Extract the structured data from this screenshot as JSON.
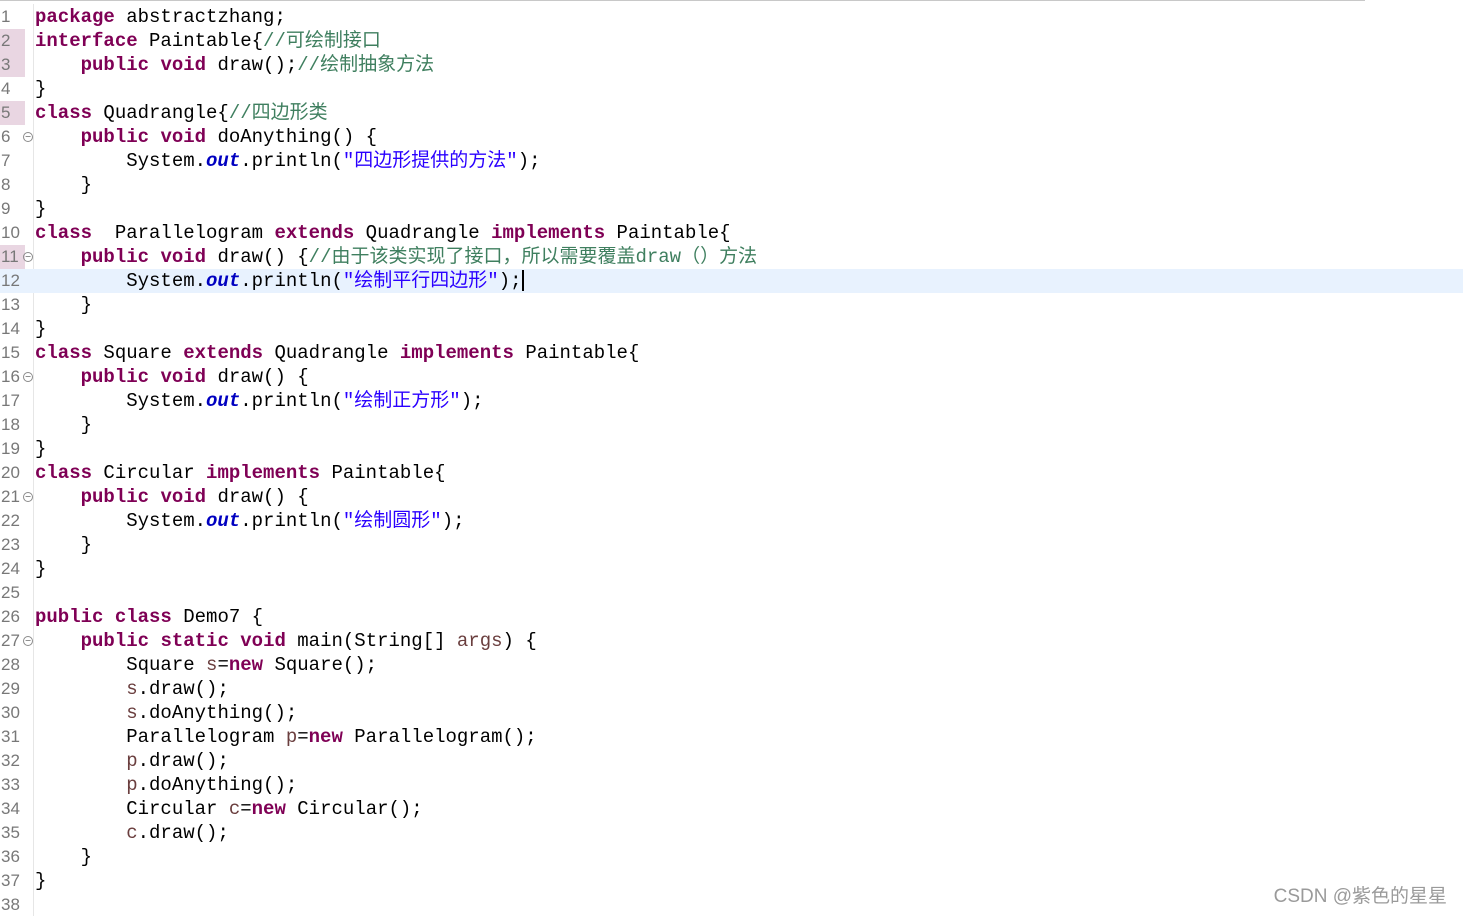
{
  "editor": {
    "language": "java",
    "current_line": 12,
    "lines": [
      {
        "n": "1",
        "tokens": [
          [
            "kw",
            "package"
          ],
          [
            "t",
            " abstractzhang;"
          ]
        ]
      },
      {
        "n": "2",
        "mark": true,
        "tokens": [
          [
            "kw",
            "interface"
          ],
          [
            "t",
            " Paintable{"
          ],
          [
            "cmt",
            "//可绘制接口"
          ]
        ]
      },
      {
        "n": "3",
        "mark": true,
        "tokens": [
          [
            "t",
            "    "
          ],
          [
            "kw",
            "public"
          ],
          [
            "t",
            " "
          ],
          [
            "kw",
            "void"
          ],
          [
            "t",
            " draw();"
          ],
          [
            "cmt",
            "//绘制抽象方法"
          ]
        ]
      },
      {
        "n": "4",
        "tokens": [
          [
            "t",
            "}"
          ]
        ]
      },
      {
        "n": "5",
        "mark": true,
        "tokens": [
          [
            "kw",
            "class"
          ],
          [
            "t",
            " Quadrangle{"
          ],
          [
            "cmt",
            "//四边形类"
          ]
        ]
      },
      {
        "n": "6",
        "fold": true,
        "tokens": [
          [
            "t",
            "    "
          ],
          [
            "kw",
            "public"
          ],
          [
            "t",
            " "
          ],
          [
            "kw",
            "void"
          ],
          [
            "t",
            " doAnything() {"
          ]
        ]
      },
      {
        "n": "7",
        "tokens": [
          [
            "t",
            "        System."
          ],
          [
            "fld",
            "out"
          ],
          [
            "t",
            ".println("
          ],
          [
            "str",
            "\"四边形提供的方法\""
          ],
          [
            "t",
            ");"
          ]
        ]
      },
      {
        "n": "8",
        "tokens": [
          [
            "t",
            "    }"
          ]
        ]
      },
      {
        "n": "9",
        "tokens": [
          [
            "t",
            "}"
          ]
        ]
      },
      {
        "n": "10",
        "tokens": [
          [
            "kw",
            "class"
          ],
          [
            "t",
            "  Parallelogram "
          ],
          [
            "kw",
            "extends"
          ],
          [
            "t",
            " Quadrangle "
          ],
          [
            "kw",
            "implements"
          ],
          [
            "t",
            " Paintable{"
          ]
        ]
      },
      {
        "n": "11",
        "fold": true,
        "mark": true,
        "tokens": [
          [
            "t",
            "    "
          ],
          [
            "kw",
            "public"
          ],
          [
            "t",
            " "
          ],
          [
            "kw",
            "void"
          ],
          [
            "t",
            " draw() {"
          ],
          [
            "cmt",
            "//由于该类实现了接口，所以需要覆盖draw（）方法"
          ]
        ]
      },
      {
        "n": "12",
        "caret": true,
        "tokens": [
          [
            "t",
            "        System."
          ],
          [
            "fld",
            "out"
          ],
          [
            "t",
            ".println("
          ],
          [
            "str",
            "\"绘制平行四边形\""
          ],
          [
            "t",
            ");"
          ]
        ]
      },
      {
        "n": "13",
        "tokens": [
          [
            "t",
            "    }"
          ]
        ]
      },
      {
        "n": "14",
        "tokens": [
          [
            "t",
            "}"
          ]
        ]
      },
      {
        "n": "15",
        "tokens": [
          [
            "kw",
            "class"
          ],
          [
            "t",
            " Square "
          ],
          [
            "kw",
            "extends"
          ],
          [
            "t",
            " Quadrangle "
          ],
          [
            "kw",
            "implements"
          ],
          [
            "t",
            " Paintable{"
          ]
        ]
      },
      {
        "n": "16",
        "fold": true,
        "tokens": [
          [
            "t",
            "    "
          ],
          [
            "kw",
            "public"
          ],
          [
            "t",
            " "
          ],
          [
            "kw",
            "void"
          ],
          [
            "t",
            " draw() {"
          ]
        ]
      },
      {
        "n": "17",
        "tokens": [
          [
            "t",
            "        System."
          ],
          [
            "fld",
            "out"
          ],
          [
            "t",
            ".println("
          ],
          [
            "str",
            "\"绘制正方形\""
          ],
          [
            "t",
            ");"
          ]
        ]
      },
      {
        "n": "18",
        "tokens": [
          [
            "t",
            "    }"
          ]
        ]
      },
      {
        "n": "19",
        "tokens": [
          [
            "t",
            "}"
          ]
        ]
      },
      {
        "n": "20",
        "tokens": [
          [
            "kw",
            "class"
          ],
          [
            "t",
            " Circular "
          ],
          [
            "kw",
            "implements"
          ],
          [
            "t",
            " Paintable{"
          ]
        ]
      },
      {
        "n": "21",
        "fold": true,
        "tokens": [
          [
            "t",
            "    "
          ],
          [
            "kw",
            "public"
          ],
          [
            "t",
            " "
          ],
          [
            "kw",
            "void"
          ],
          [
            "t",
            " draw() {"
          ]
        ]
      },
      {
        "n": "22",
        "tokens": [
          [
            "t",
            "        System."
          ],
          [
            "fld",
            "out"
          ],
          [
            "t",
            ".println("
          ],
          [
            "str",
            "\"绘制圆形\""
          ],
          [
            "t",
            ");"
          ]
        ]
      },
      {
        "n": "23",
        "tokens": [
          [
            "t",
            "    }"
          ]
        ]
      },
      {
        "n": "24",
        "tokens": [
          [
            "t",
            "}"
          ]
        ]
      },
      {
        "n": "25",
        "tokens": []
      },
      {
        "n": "26",
        "tokens": [
          [
            "kw",
            "public"
          ],
          [
            "t",
            " "
          ],
          [
            "kw",
            "class"
          ],
          [
            "t",
            " Demo7 {"
          ]
        ]
      },
      {
        "n": "27",
        "fold": true,
        "tokens": [
          [
            "t",
            "    "
          ],
          [
            "kw",
            "public"
          ],
          [
            "t",
            " "
          ],
          [
            "kw",
            "static"
          ],
          [
            "t",
            " "
          ],
          [
            "kw",
            "void"
          ],
          [
            "t",
            " main(String[] "
          ],
          [
            "var",
            "args"
          ],
          [
            "t",
            ") {"
          ]
        ]
      },
      {
        "n": "28",
        "tokens": [
          [
            "t",
            "        Square "
          ],
          [
            "var",
            "s"
          ],
          [
            "t",
            "="
          ],
          [
            "kw",
            "new"
          ],
          [
            "t",
            " Square();"
          ]
        ]
      },
      {
        "n": "29",
        "tokens": [
          [
            "t",
            "        "
          ],
          [
            "var",
            "s"
          ],
          [
            "t",
            ".draw();"
          ]
        ]
      },
      {
        "n": "30",
        "tokens": [
          [
            "t",
            "        "
          ],
          [
            "var",
            "s"
          ],
          [
            "t",
            ".doAnything();"
          ]
        ]
      },
      {
        "n": "31",
        "tokens": [
          [
            "t",
            "        Parallelogram "
          ],
          [
            "var",
            "p"
          ],
          [
            "t",
            "="
          ],
          [
            "kw",
            "new"
          ],
          [
            "t",
            " Parallelogram();"
          ]
        ]
      },
      {
        "n": "32",
        "tokens": [
          [
            "t",
            "        "
          ],
          [
            "var",
            "p"
          ],
          [
            "t",
            ".draw();"
          ]
        ]
      },
      {
        "n": "33",
        "tokens": [
          [
            "t",
            "        "
          ],
          [
            "var",
            "p"
          ],
          [
            "t",
            ".doAnything();"
          ]
        ]
      },
      {
        "n": "34",
        "tokens": [
          [
            "t",
            "        Circular "
          ],
          [
            "var",
            "c"
          ],
          [
            "t",
            "="
          ],
          [
            "kw",
            "new"
          ],
          [
            "t",
            " Circular();"
          ]
        ]
      },
      {
        "n": "35",
        "tokens": [
          [
            "t",
            "        "
          ],
          [
            "var",
            "c"
          ],
          [
            "t",
            ".draw();"
          ]
        ]
      },
      {
        "n": "36",
        "tokens": [
          [
            "t",
            "    }"
          ]
        ]
      },
      {
        "n": "37",
        "tokens": [
          [
            "t",
            "}"
          ]
        ]
      },
      {
        "n": "38",
        "tokens": []
      }
    ]
  },
  "watermark": "CSDN @紫色的星星",
  "colors": {
    "keyword": "#7f0055",
    "string": "#2a00ff",
    "comment": "#3f7f5f",
    "static_field": "#0000c0",
    "local_variable": "#6a3e3e",
    "current_line_bg": "#e8f2fe",
    "gutter_mark": "#e9d6e2"
  }
}
